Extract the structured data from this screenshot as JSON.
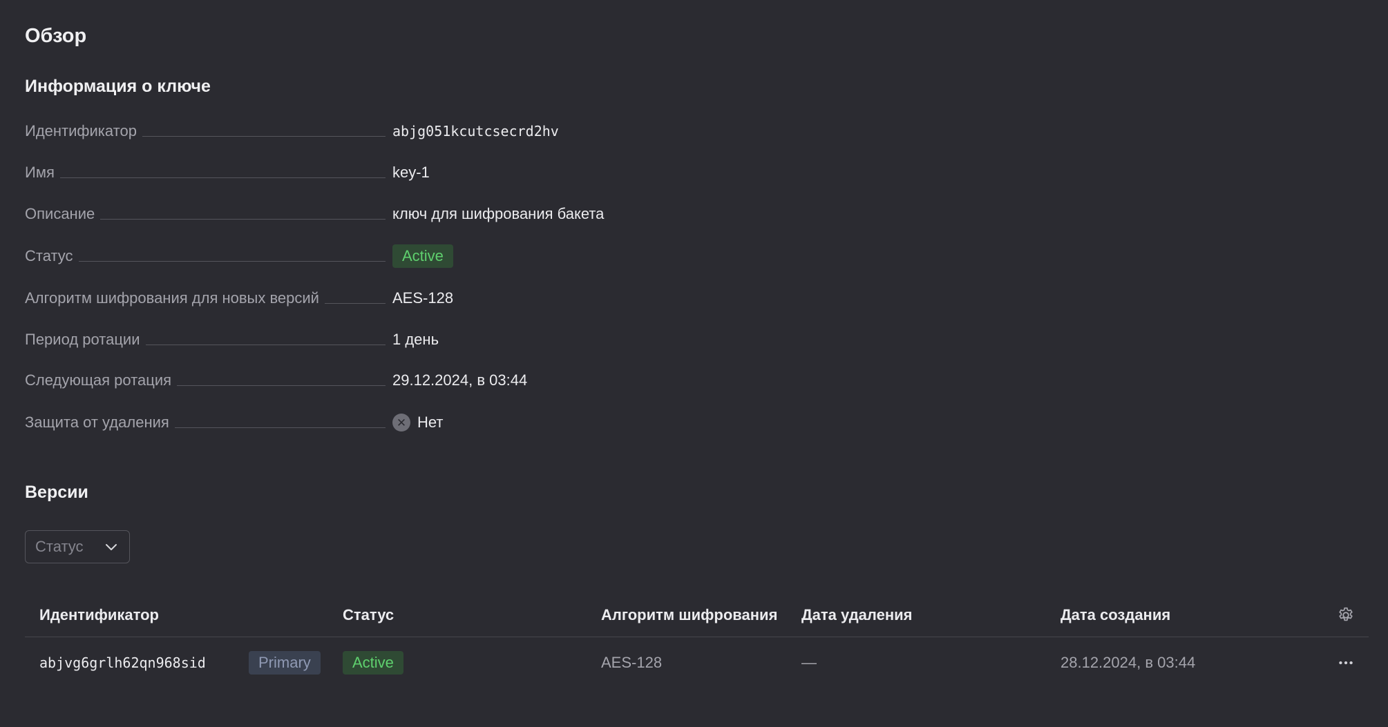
{
  "page": {
    "title": "Обзор"
  },
  "key_info": {
    "title": "Информация о ключе",
    "rows": [
      {
        "label": "Идентификатор",
        "value": "abjg051kcutcsecrd2hv"
      },
      {
        "label": "Имя",
        "value": "key-1"
      },
      {
        "label": "Описание",
        "value": "ключ для шифрования бакета"
      },
      {
        "label": "Статус",
        "value": "Active"
      },
      {
        "label": "Алгоритм шифрования для новых версий",
        "value": "AES-128"
      },
      {
        "label": "Период ротации",
        "value": "1 день"
      },
      {
        "label": "Следующая ротация",
        "value": "29.12.2024, в 03:44"
      },
      {
        "label": "Защита от удаления",
        "value": "Нет"
      }
    ],
    "deletion_protection_icon": "x-circle-icon"
  },
  "versions": {
    "title": "Версии",
    "filter": {
      "label": "Статус",
      "icon": "chevron-down-icon"
    },
    "columns": [
      "Идентификатор",
      "Статус",
      "Алгоритм шифрования",
      "Дата удаления",
      "Дата создания"
    ],
    "settings_icon": "gear-icon",
    "rows": [
      {
        "id": "abjvg6grlh62qn968sid",
        "tag": "Primary",
        "status": "Active",
        "algorithm": "AES-128",
        "deletion_date": "—",
        "creation_date": "28.12.2024, в 03:44",
        "actions_icon": "more-horizontal-icon"
      }
    ]
  },
  "colors": {
    "background": "#2b2b31",
    "active_text": "#5fd06e",
    "active_bg": "#2f4a34",
    "primary_text": "#8f99b3",
    "primary_bg": "#3a4150"
  }
}
